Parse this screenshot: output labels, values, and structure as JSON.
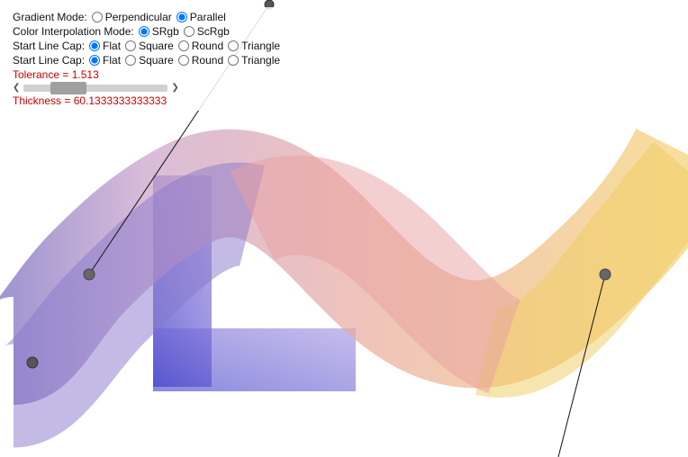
{
  "controls": {
    "gradient_mode_label": "Gradient Mode:",
    "gradient_options": [
      "Perpendicular",
      "Parallel"
    ],
    "gradient_selected": "Parallel",
    "color_interp_label": "Color Interpolation Mode:",
    "color_interp_options": [
      "SRgb",
      "ScRgb"
    ],
    "color_interp_selected": "SRgb",
    "start_line_cap_label": "Start Line Cap:",
    "start_line_cap_options": [
      "Flat",
      "Square",
      "Round",
      "Triangle"
    ],
    "start_line_cap_selected": "Flat",
    "end_line_cap_label": "Start Line Cap:",
    "end_line_cap_options": [
      "Flat",
      "Square",
      "Round",
      "Triangle"
    ],
    "end_line_cap_selected": "Flat",
    "tolerance_label": "Tolerance = 1.513",
    "thickness_label": "Thickness = 60.1333333333333"
  }
}
